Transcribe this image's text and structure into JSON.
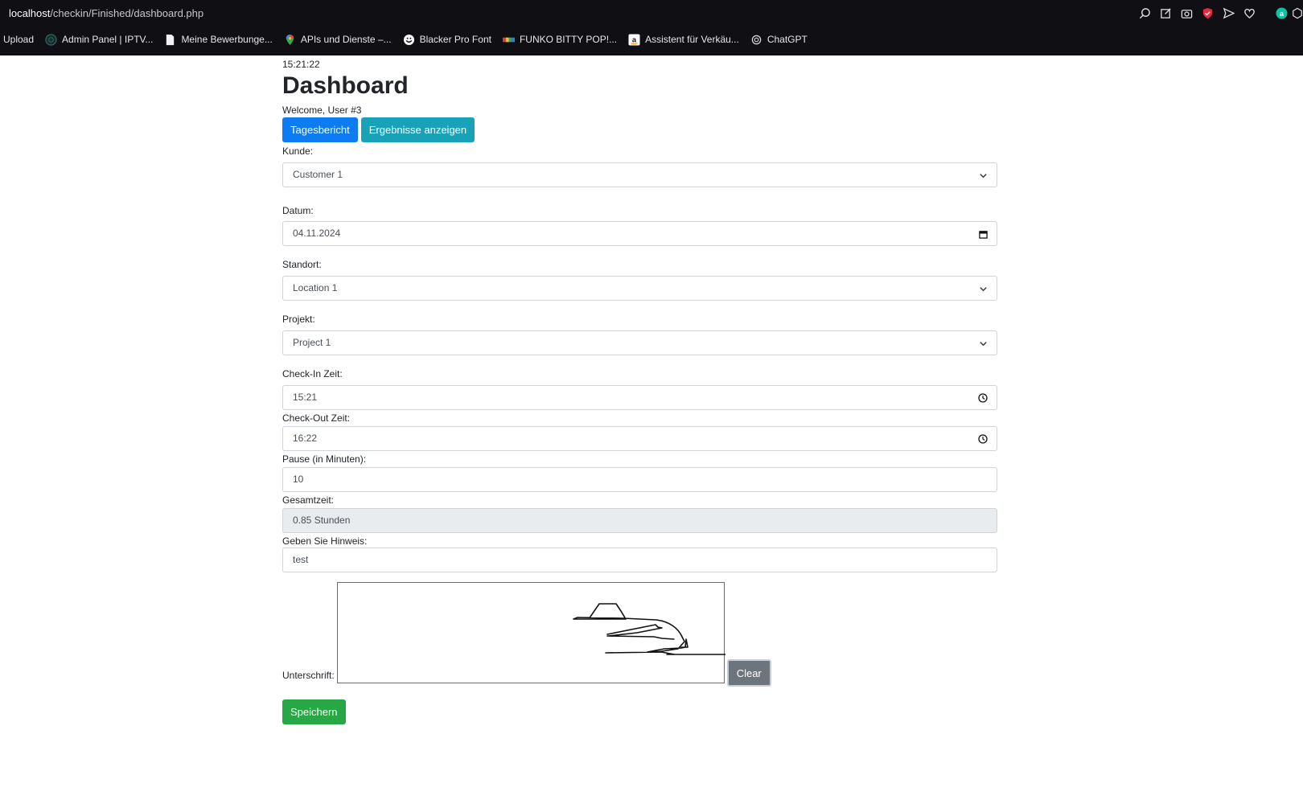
{
  "browser": {
    "url_host": "localhost",
    "url_path": "/checkin/Finished/dashboard.php",
    "bookmarks": [
      {
        "label": "Upload",
        "icon": "none"
      },
      {
        "label": "Admin Panel | IPTV...",
        "icon": "circle-logo-icon"
      },
      {
        "label": "Meine Bewerbunge...",
        "icon": "page-icon"
      },
      {
        "label": "APIs und Dienste –...",
        "icon": "maps-pin-icon"
      },
      {
        "label": "Blacker Pro Font",
        "icon": "smile-icon"
      },
      {
        "label": "FUNKO BITTY POP!...",
        "icon": "color-bars-icon"
      },
      {
        "label": "Assistent für Verkäu...",
        "icon": "amazon-icon"
      },
      {
        "label": "ChatGPT",
        "icon": "openai-icon"
      }
    ]
  },
  "page": {
    "time": "15:21:22",
    "title": "Dashboard",
    "welcome": "Welcome, User #3",
    "buttons": {
      "daily_report": "Tagesbericht",
      "show_results": "Ergebnisse anzeigen",
      "clear": "Clear",
      "save": "Speichern"
    },
    "form": {
      "customer_label": "Kunde:",
      "customer_value": "Customer 1",
      "date_label": "Datum:",
      "date_value": "04.11.2024",
      "location_label": "Standort:",
      "location_value": "Location 1",
      "project_label": "Projekt:",
      "project_value": "Project 1",
      "checkin_label": "Check-In Zeit:",
      "checkin_value": "15:21",
      "checkout_label": "Check-Out Zeit:",
      "checkout_value": "16:22",
      "pause_label": "Pause (in Minuten):",
      "pause_value": "10",
      "total_label": "Gesamtzeit:",
      "total_value": "0.85 Stunden",
      "note_label": "Geben Sie Hinweis:",
      "note_value": "test",
      "signature_label": "Unterschrift:"
    }
  },
  "colors": {
    "primary": "#0d7cf2",
    "info": "#17a2b8",
    "secondary": "#6c757d",
    "success": "#28a745",
    "chrome_bg": "#0f0f14"
  }
}
